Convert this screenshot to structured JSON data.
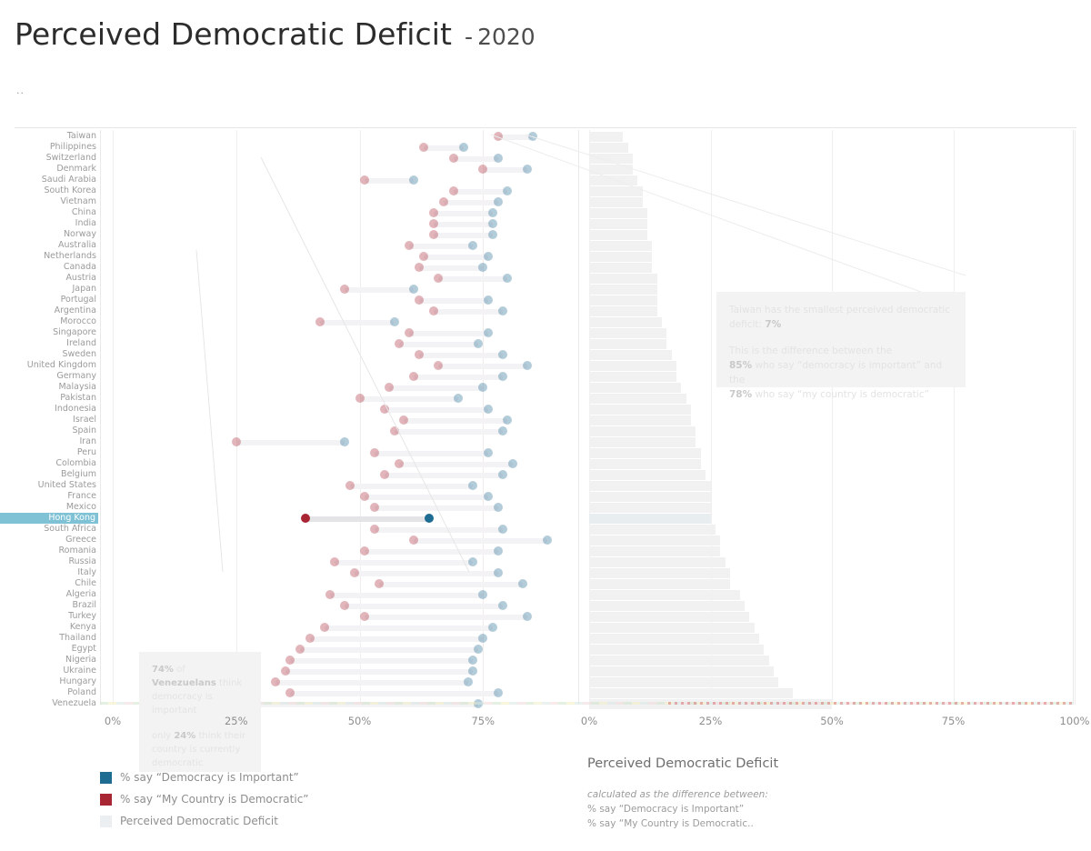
{
  "header": {
    "title": "Perceived Democratic Deficit",
    "separator": "-",
    "year": "2020",
    "subtitle": ".."
  },
  "legend": {
    "items": [
      {
        "label": "% say “Democracy is Important”",
        "color": "#1f6c93",
        "name": "democracy-important"
      },
      {
        "label": "% say “My Country is Democratic”",
        "color": "#a82634",
        "name": "country-democratic"
      },
      {
        "label": "Perceived Democratic Deficit",
        "color": "#eceff1",
        "name": "perceived-deficit"
      }
    ]
  },
  "right_caption": {
    "title": "Perceived Democratic Deficit",
    "italic_line": "calculated as the difference between:",
    "line1": "% say “Democracy is Important”",
    "line2": "% say “My Country is Democratic.."
  },
  "annotations": {
    "taiwan": {
      "line1_pre": "Taiwan has the smallest perceived democratic",
      "line2_pre": "deficit: ",
      "line2_val": "7%",
      "line3": "This is the difference between the",
      "line4_val": "85%",
      "line4_post": " who say “democracy is important” and the",
      "line5_val": "78%",
      "line5_post": " who say “my country is democratic”"
    },
    "venezuela": {
      "p1_val": "74%",
      "p1_mid": " of ",
      "p1_name": "Venezuelans",
      "p1_rest": " think democracy is important",
      "p2_pre": "only ",
      "p2_val": "24%",
      "p2_rest": " think their country is currently democratic"
    }
  },
  "axes": {
    "left_ticks": [
      "0%",
      "25%",
      "50%",
      "75%"
    ],
    "right_ticks": [
      "0%",
      "25%",
      "50%",
      "75%",
      "100%"
    ]
  },
  "highlight_country": "Hong Kong",
  "chart_data": {
    "type": "bar",
    "title": "Perceived Democratic Deficit - 2020",
    "xlabel": "",
    "ylabel": "",
    "left_panel": {
      "type": "dumbbell",
      "xlim": [
        0,
        88
      ],
      "ticks": [
        0,
        25,
        50,
        75
      ],
      "series": [
        {
          "name": "% say “My Country is Democratic”",
          "color": "#a82634"
        },
        {
          "name": "% say “Democracy is Important”",
          "color": "#1f6c93"
        }
      ]
    },
    "right_panel": {
      "type": "bar",
      "title": "Perceived Democratic Deficit",
      "xlim": [
        0,
        100
      ],
      "ticks": [
        0,
        25,
        50,
        75,
        100
      ]
    },
    "categories": [
      "Taiwan",
      "Philippines",
      "Switzerland",
      "Denmark",
      "Saudi Arabia",
      "South Korea",
      "Vietnam",
      "China",
      "India",
      "Norway",
      "Australia",
      "Netherlands",
      "Canada",
      "Austria",
      "Japan",
      "Portugal",
      "Argentina",
      "Morocco",
      "Singapore",
      "Ireland",
      "Sweden",
      "United Kingdom",
      "Germany",
      "Malaysia",
      "Pakistan",
      "Indonesia",
      "Israel",
      "Spain",
      "Iran",
      "Peru",
      "Colombia",
      "Belgium",
      "United States",
      "France",
      "Mexico",
      "Hong Kong",
      "South Africa",
      "Greece",
      "Romania",
      "Russia",
      "Italy",
      "Chile",
      "Algeria",
      "Brazil",
      "Turkey",
      "Kenya",
      "Thailand",
      "Egypt",
      "Nigeria",
      "Ukraine",
      "Hungary",
      "Poland",
      "Venezuela"
    ],
    "rows": [
      {
        "country": "Taiwan",
        "democratic": 78,
        "important": 85,
        "deficit": 7
      },
      {
        "country": "Philippines",
        "democratic": 63,
        "important": 71,
        "deficit": 8
      },
      {
        "country": "Switzerland",
        "democratic": 69,
        "important": 78,
        "deficit": 9
      },
      {
        "country": "Denmark",
        "democratic": 75,
        "important": 84,
        "deficit": 9
      },
      {
        "country": "Saudi Arabia",
        "democratic": 51,
        "important": 61,
        "deficit": 10
      },
      {
        "country": "South Korea",
        "democratic": 69,
        "important": 80,
        "deficit": 11
      },
      {
        "country": "Vietnam",
        "democratic": 67,
        "important": 78,
        "deficit": 11
      },
      {
        "country": "China",
        "democratic": 65,
        "important": 77,
        "deficit": 12
      },
      {
        "country": "India",
        "democratic": 65,
        "important": 77,
        "deficit": 12
      },
      {
        "country": "Norway",
        "democratic": 65,
        "important": 77,
        "deficit": 12
      },
      {
        "country": "Australia",
        "democratic": 60,
        "important": 73,
        "deficit": 13
      },
      {
        "country": "Netherlands",
        "democratic": 63,
        "important": 76,
        "deficit": 13
      },
      {
        "country": "Canada",
        "democratic": 62,
        "important": 75,
        "deficit": 13
      },
      {
        "country": "Austria",
        "democratic": 66,
        "important": 80,
        "deficit": 14
      },
      {
        "country": "Japan",
        "democratic": 47,
        "important": 61,
        "deficit": 14
      },
      {
        "country": "Portugal",
        "democratic": 62,
        "important": 76,
        "deficit": 14
      },
      {
        "country": "Argentina",
        "democratic": 65,
        "important": 79,
        "deficit": 14
      },
      {
        "country": "Morocco",
        "democratic": 42,
        "important": 57,
        "deficit": 15
      },
      {
        "country": "Singapore",
        "democratic": 60,
        "important": 76,
        "deficit": 16
      },
      {
        "country": "Ireland",
        "democratic": 58,
        "important": 74,
        "deficit": 16
      },
      {
        "country": "Sweden",
        "democratic": 62,
        "important": 79,
        "deficit": 17
      },
      {
        "country": "United Kingdom",
        "democratic": 66,
        "important": 84,
        "deficit": 18
      },
      {
        "country": "Germany",
        "democratic": 61,
        "important": 79,
        "deficit": 18
      },
      {
        "country": "Malaysia",
        "democratic": 56,
        "important": 75,
        "deficit": 19
      },
      {
        "country": "Pakistan",
        "democratic": 50,
        "important": 70,
        "deficit": 20
      },
      {
        "country": "Indonesia",
        "democratic": 55,
        "important": 76,
        "deficit": 21
      },
      {
        "country": "Israel",
        "democratic": 59,
        "important": 80,
        "deficit": 21
      },
      {
        "country": "Spain",
        "democratic": 57,
        "important": 79,
        "deficit": 22
      },
      {
        "country": "Iran",
        "democratic": 25,
        "important": 47,
        "deficit": 22
      },
      {
        "country": "Peru",
        "democratic": 53,
        "important": 76,
        "deficit": 23
      },
      {
        "country": "Colombia",
        "democratic": 58,
        "important": 81,
        "deficit": 23
      },
      {
        "country": "Belgium",
        "democratic": 55,
        "important": 79,
        "deficit": 24
      },
      {
        "country": "United States",
        "democratic": 48,
        "important": 73,
        "deficit": 25
      },
      {
        "country": "France",
        "democratic": 51,
        "important": 76,
        "deficit": 25
      },
      {
        "country": "Mexico",
        "democratic": 53,
        "important": 78,
        "deficit": 25
      },
      {
        "country": "Hong Kong",
        "democratic": 39,
        "important": 64,
        "deficit": 25
      },
      {
        "country": "South Africa",
        "democratic": 53,
        "important": 79,
        "deficit": 26
      },
      {
        "country": "Greece",
        "democratic": 61,
        "important": 88,
        "deficit": 27
      },
      {
        "country": "Romania",
        "democratic": 51,
        "important": 78,
        "deficit": 27
      },
      {
        "country": "Russia",
        "democratic": 45,
        "important": 73,
        "deficit": 28
      },
      {
        "country": "Italy",
        "democratic": 49,
        "important": 78,
        "deficit": 29
      },
      {
        "country": "Chile",
        "democratic": 54,
        "important": 83,
        "deficit": 29
      },
      {
        "country": "Algeria",
        "democratic": 44,
        "important": 75,
        "deficit": 31
      },
      {
        "country": "Brazil",
        "democratic": 47,
        "important": 79,
        "deficit": 32
      },
      {
        "country": "Turkey",
        "democratic": 51,
        "important": 84,
        "deficit": 33
      },
      {
        "country": "Kenya",
        "democratic": 43,
        "important": 77,
        "deficit": 34
      },
      {
        "country": "Thailand",
        "democratic": 40,
        "important": 75,
        "deficit": 35
      },
      {
        "country": "Egypt",
        "democratic": 38,
        "important": 74,
        "deficit": 36
      },
      {
        "country": "Nigeria",
        "democratic": 36,
        "important": 73,
        "deficit": 37
      },
      {
        "country": "Ukraine",
        "democratic": 35,
        "important": 73,
        "deficit": 38
      },
      {
        "country": "Hungary",
        "democratic": 33,
        "important": 72,
        "deficit": 39
      },
      {
        "country": "Poland",
        "democratic": 36,
        "important": 78,
        "deficit": 42
      },
      {
        "country": "Venezuela",
        "democratic": 24,
        "important": 74,
        "deficit": 50
      }
    ]
  }
}
